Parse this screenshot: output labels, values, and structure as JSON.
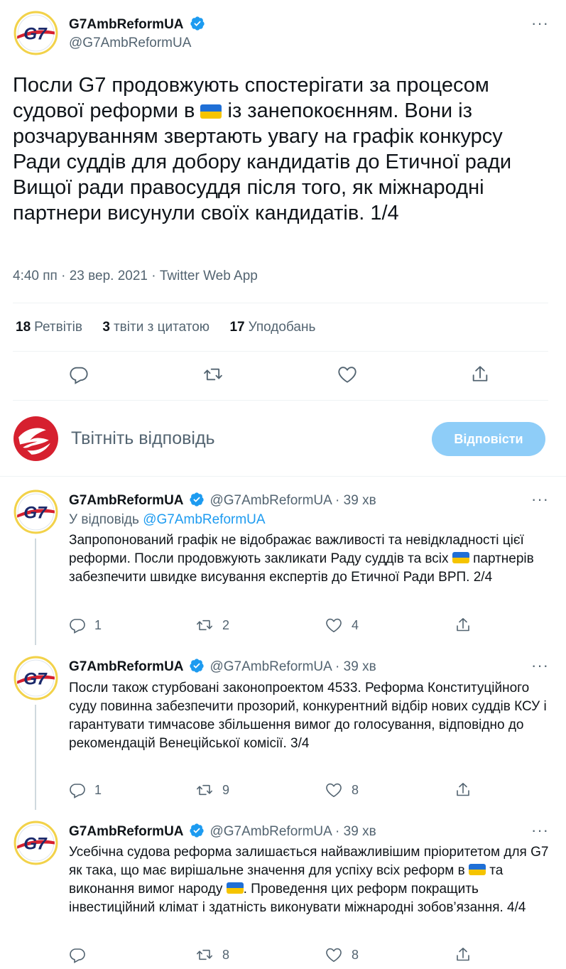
{
  "main_tweet": {
    "display_name": "G7AmbReformUA",
    "handle": "@G7AmbReformUA",
    "text_parts": [
      "Посли G7 продовжують спостерігати за процесом судової реформи в ",
      " із занепокоєнням. Вони із розчаруванням звертають увагу на графік конкурсу Ради суддів для добору кандидатів до Етичної ради Вищої ради правосуддя після того, як міжнародні партнери висунули своїх кандидатів. 1/4"
    ],
    "timestamp": "4:40 пп · 23 вер. 2021 · Twitter Web App",
    "stats": {
      "retweets_count": "18",
      "retweets_label": "Ретвітів",
      "quotes_count": "3",
      "quotes_label": "твіти з цитатою",
      "likes_count": "17",
      "likes_label": "Уподобань"
    }
  },
  "compose": {
    "placeholder": "Твітніть відповідь",
    "reply_button": "Відповісти"
  },
  "replies": [
    {
      "display_name": "G7AmbReformUA",
      "handle_time": "@G7AmbReformUA · 39 хв",
      "replying_prefix": "У відповідь ",
      "replying_to": "@G7AmbReformUA",
      "text_parts": [
        "Запропонований графік не відображає важливості та невідкладності цієї реформи. Посли продовжують закликати Раду суддів та всіх ",
        " партнерів забезпечити швидке висування експертів до Етичної Ради ВРП. 2/4"
      ],
      "reply_count": "1",
      "retweet_count": "2",
      "like_count": "4"
    },
    {
      "display_name": "G7AmbReformUA",
      "handle_time": "@G7AmbReformUA · 39 хв",
      "text": "Посли також стурбовані законопроектом 4533. Реформа Конституційного суду повинна забезпечити прозорий, конкурентний відбір нових суддів КСУ і гарантувати тимчасове збільшення вимог до голосування, відповідно до рекомендацій Венеційської комісії. 3/4",
      "reply_count": "1",
      "retweet_count": "9",
      "like_count": "8"
    },
    {
      "display_name": "G7AmbReformUA",
      "handle_time": "@G7AmbReformUA · 39 хв",
      "text_parts": [
        "Усебічна судова реформа залишається найважливішим пріоритетом для G7 як така, що має вирішальне значення для успіху всіх реформ в ",
        " та виконання вимог народу ",
        ". Проведення цих реформ покращить інвестиційний клімат і здатність виконувати міжнародні зобов’язання. 4/4"
      ],
      "retweet_count": "8",
      "like_count": "8"
    }
  ],
  "colors": {
    "accent": "#1d9bf0",
    "reply_button_disabled": "#8ecdf8",
    "text_secondary": "#536471",
    "logo_red": "#d6202f",
    "logo_navy": "#1c2a6b",
    "logo_ring_yellow": "#f2d24a"
  },
  "icons": [
    "g7-logo-icon",
    "verified-badge-icon",
    "more-options-icon",
    "reply-icon",
    "retweet-icon",
    "like-icon",
    "share-icon",
    "user-avatar-icon",
    "ukraine-flag-icon"
  ]
}
